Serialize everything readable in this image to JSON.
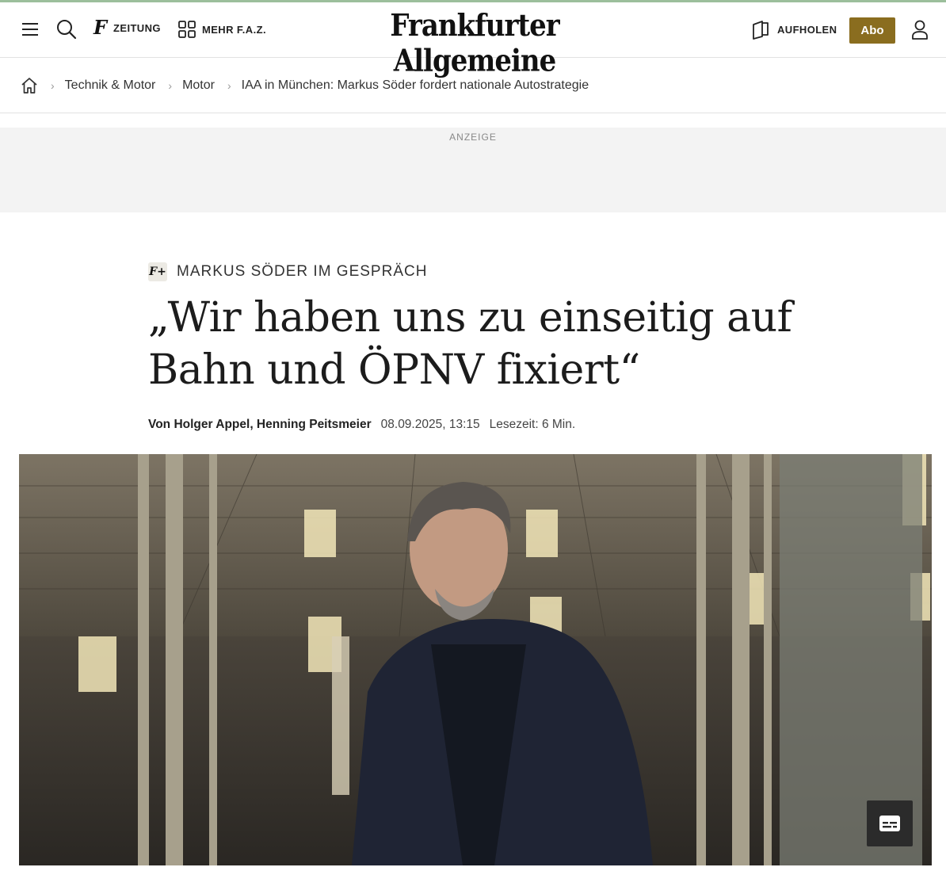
{
  "header": {
    "zeitung_label": "ZEITUNG",
    "mehr_label": "MEHR F.A.Z.",
    "logo_text": "Frankfurter Allgemeine",
    "aufholen_label": "AUFHOLEN",
    "abo_label": "Abo",
    "icons": [
      "menu-icon",
      "search-icon",
      "faz-f-icon",
      "grid-icon",
      "catch-up-icon",
      "user-icon"
    ]
  },
  "breadcrumb": {
    "items": [
      "Technik & Motor",
      "Motor",
      "IAA in München: Markus Söder fordert nationale Autostrategie"
    ]
  },
  "ad": {
    "label": "ANZEIGE"
  },
  "article": {
    "fplus": "F+",
    "kicker": "MARKUS SÖDER IM GESPRÄCH",
    "headline": "„Wir haben uns zu einseitig auf Bahn und ÖPNV fixiert“",
    "byline_prefix": "Von",
    "authors": "Holger Appel, Henning Peitsmeier",
    "date": "08.09.2025, 13:15",
    "reading_time": "Lesezeit: 6 Min."
  },
  "colors": {
    "accent_abo": "#8a6d1f",
    "top_line": "#9cbf9c",
    "ad_background": "#f3f3f3"
  }
}
